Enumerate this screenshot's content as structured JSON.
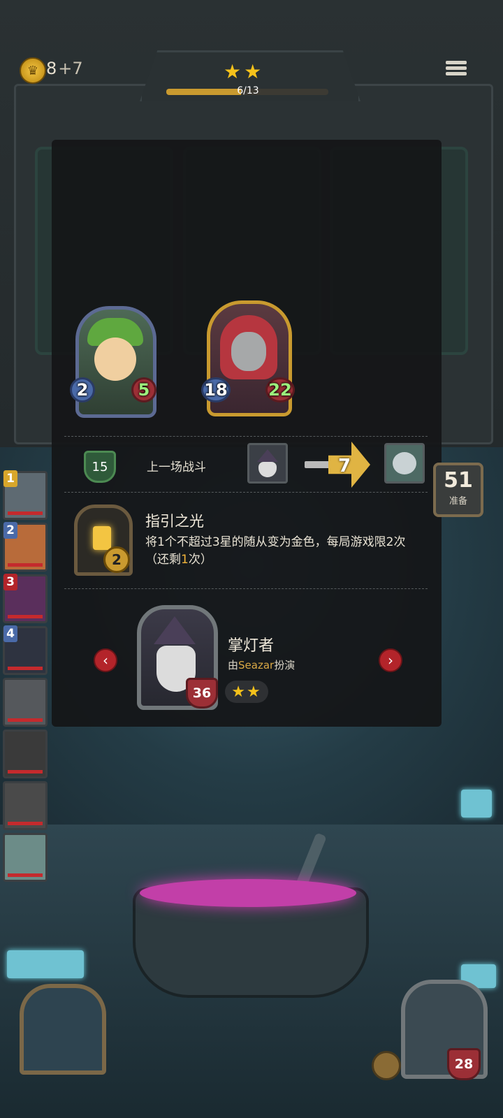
{
  "header": {
    "gold": "8",
    "gold_income": "+7",
    "stars": "★★",
    "xp_text": "6/13",
    "xp_fraction": 0.4615,
    "menu_icon": "hamburger-menu-icon"
  },
  "battle_preview": {
    "player_attack": "2",
    "player_health": "5",
    "opponent_attack": "18",
    "opponent_health": "22"
  },
  "last_fight": {
    "streak": "15",
    "label": "上一场战斗",
    "damage": "7"
  },
  "ready_counter": {
    "value": "51",
    "label": "准备"
  },
  "ability": {
    "title": "指引之光",
    "charges": "2",
    "desc_prefix": "将",
    "desc_num1": "1",
    "desc_mid1": "个不超过",
    "desc_num2": "3",
    "desc_mid2": "星的随从变为金色，每局游戏限",
    "desc_num3": "2",
    "desc_mid3": "次（还剩",
    "desc_num4": "1",
    "desc_suffix": "次）"
  },
  "unit": {
    "name": "掌灯者",
    "by": "由",
    "actor": "Seazar",
    "role": "扮演",
    "health": "36",
    "stars": "★★"
  },
  "nav": {
    "prev": "‹",
    "next": "›"
  },
  "roster": [
    {
      "tier": "1",
      "tier_color": "#d8a62b"
    },
    {
      "tier": "2",
      "tier_color": "#4a6aa8"
    },
    {
      "tier": "3",
      "tier_color": "#b3242a"
    },
    {
      "tier": "4",
      "tier_color": "#4a6aa8"
    },
    {
      "tier": "",
      "tier_color": ""
    },
    {
      "tier": "",
      "tier_color": ""
    },
    {
      "tier": "",
      "tier_color": ""
    },
    {
      "tier": "",
      "tier_color": ""
    }
  ],
  "bottom": {
    "opponent_health": "28"
  },
  "colors": {
    "accent_gold": "#f5c21b",
    "health_red": "#9c2f36",
    "attack_blue": "#4a6aa8",
    "brew_pink": "#c23fa8"
  }
}
